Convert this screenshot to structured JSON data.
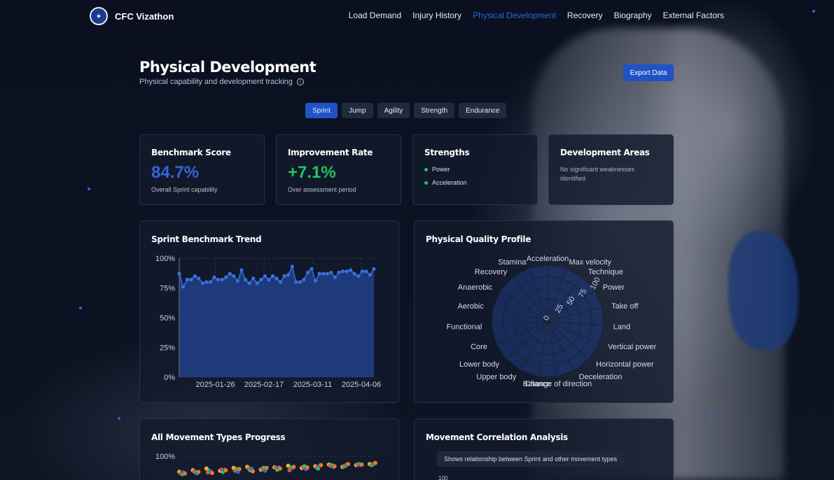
{
  "app": {
    "name": "CFC Vizathon"
  },
  "nav": {
    "items": [
      {
        "label": "Load Demand",
        "active": false
      },
      {
        "label": "Injury History",
        "active": false
      },
      {
        "label": "Physical Development",
        "active": true
      },
      {
        "label": "Recovery",
        "active": false
      },
      {
        "label": "Biography",
        "active": false
      },
      {
        "label": "External Factors",
        "active": false
      }
    ]
  },
  "header": {
    "title": "Physical Development",
    "subtitle": "Physical capability and development tracking",
    "export_label": "Export Data"
  },
  "tabs": [
    {
      "label": "Sprint",
      "active": true
    },
    {
      "label": "Jump",
      "active": false
    },
    {
      "label": "Agility",
      "active": false
    },
    {
      "label": "Strength",
      "active": false
    },
    {
      "label": "Endurance",
      "active": false
    }
  ],
  "stats": {
    "benchmark": {
      "title": "Benchmark Score",
      "value": "84.7%",
      "sub": "Overall Sprint capability",
      "color": "#2f66d9"
    },
    "improvement": {
      "title": "Improvement Rate",
      "value": "+7.1%",
      "sub": "Over assessment period",
      "color": "#22c55e"
    },
    "strengths": {
      "title": "Strengths",
      "items": [
        "Power",
        "Acceleration"
      ]
    },
    "development": {
      "title": "Development Areas",
      "text": "No significant weaknesses identified"
    }
  },
  "panels": {
    "trend_title": "Sprint Benchmark Trend",
    "radar_title": "Physical Quality Profile",
    "progress_title": "All Movement Types Progress",
    "correlation_title": "Movement Correlation Analysis",
    "correlation_note": "Shows relationship between Sprint and other movement types",
    "correlation_axis_top": "100"
  },
  "colors": {
    "accent": "#2f66d9",
    "positive": "#22c55e",
    "background": "#0b1120"
  },
  "chart_data": [
    {
      "type": "area",
      "title": "Sprint Benchmark Trend",
      "xlabel": "",
      "ylabel": "",
      "ylim": [
        0,
        100
      ],
      "yticks": [
        "0%",
        "25%",
        "50%",
        "75%",
        "100%"
      ],
      "xticks": [
        "2025-01-26",
        "2025-02-17",
        "2025-03-11",
        "2025-04-06"
      ],
      "values": [
        87,
        76,
        82,
        82,
        85,
        83,
        79,
        80,
        80,
        84,
        82,
        82,
        84,
        87,
        85,
        81,
        90,
        82,
        79,
        83,
        79,
        82,
        85,
        82,
        85,
        83,
        80,
        85,
        86,
        93,
        80,
        80,
        82,
        88,
        91,
        81,
        87,
        87,
        87,
        88,
        84,
        88,
        89,
        89,
        90,
        87,
        85,
        89,
        89,
        86,
        91
      ]
    },
    {
      "type": "radar",
      "title": "Physical Quality Profile",
      "radial_ticks": [
        "0",
        "25",
        "50",
        "75",
        "100"
      ],
      "axes": [
        "Acceleration",
        "Max velocity",
        "Technique",
        "Power",
        "Take off",
        "Land",
        "Vertical power",
        "Horizontal power",
        "Deceleration",
        "Change of direction",
        "Balance",
        "Upper body",
        "Lower body",
        "Core",
        "Functional",
        "Aerobic",
        "Anaerobic",
        "Recovery",
        "Stamina"
      ]
    },
    {
      "type": "scatter",
      "title": "All Movement Types Progress",
      "ylim": [
        0,
        100
      ],
      "yticks": [
        "100%"
      ],
      "series": [
        {
          "values": [
            72,
            75,
            78,
            74,
            79,
            81,
            76,
            80,
            83,
            79,
            82,
            85,
            81,
            84,
            86
          ]
        },
        {
          "values": [
            70,
            73,
            71,
            76,
            74,
            78,
            77,
            79,
            75,
            81,
            80,
            83,
            82,
            85,
            84
          ]
        },
        {
          "values": [
            68,
            71,
            74,
            72,
            77,
            75,
            79,
            76,
            80,
            82,
            78,
            84,
            83,
            86,
            85
          ]
        },
        {
          "values": [
            71,
            69,
            73,
            76,
            72,
            78,
            74,
            80,
            79,
            77,
            83,
            81,
            85,
            84,
            87
          ]
        },
        {
          "values": [
            69,
            72,
            70,
            75,
            77,
            73,
            79,
            78,
            81,
            80,
            84,
            82,
            86,
            85,
            88
          ]
        }
      ]
    }
  ]
}
